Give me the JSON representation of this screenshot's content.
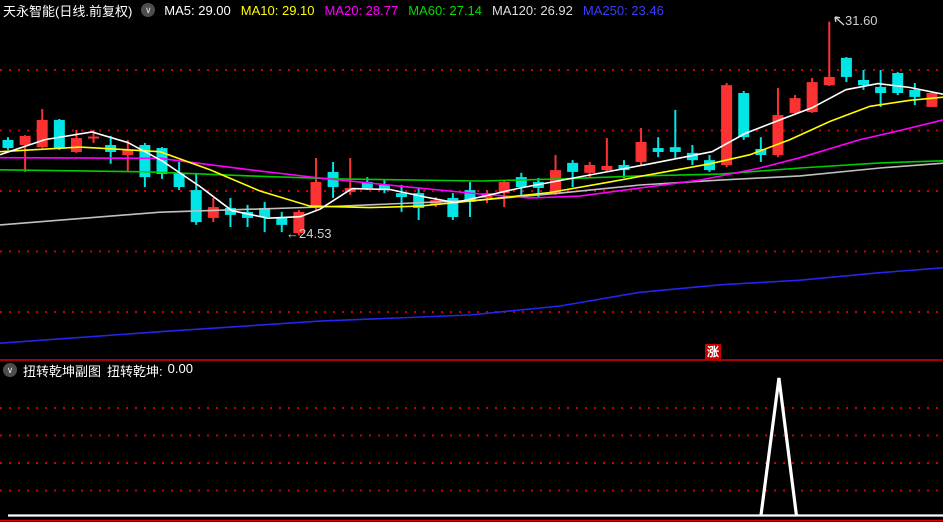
{
  "header": {
    "title": "天永智能(日线.前复权)",
    "ma_legend": [
      {
        "label": "MA5:",
        "value": "29.00",
        "color": "#ffffff"
      },
      {
        "label": "MA10:",
        "value": "29.10",
        "color": "#ffff00"
      },
      {
        "label": "MA20:",
        "value": "28.77",
        "color": "#ff00ff"
      },
      {
        "label": "MA60:",
        "value": "27.14",
        "color": "#00dd00"
      },
      {
        "label": "MA120:",
        "value": "26.92",
        "color": "#dddddd"
      },
      {
        "label": "MA250:",
        "value": "23.46",
        "color": "#3b3bff"
      }
    ]
  },
  "icons": {
    "collapse_glyph": "∨"
  },
  "annotations": {
    "high_label": "31.60",
    "low_arrow": "←",
    "low_label": "24.53",
    "zhang_badge": "涨",
    "badge_color": "#c80000"
  },
  "subchart": {
    "title": "扭转乾坤副图",
    "indicator_label": "扭转乾坤:",
    "indicator_value": "0.00"
  },
  "chart_data": {
    "type": "candlestick",
    "symbol": "天永智能",
    "period": "日线",
    "adjust": "前复权",
    "up_color": "#fa3232",
    "down_color": "#00e5e5",
    "grid_color": "#cc0000",
    "divider_color": "#e00000",
    "signal_line_color": "#ffffff",
    "price_gridlines": [
      30,
      28,
      26,
      24,
      22
    ],
    "visible_price_range": [
      20.5,
      31.65
    ],
    "high_point": {
      "bar": 48,
      "price": 31.6
    },
    "low_point": {
      "bar": 17,
      "price": 24.53
    },
    "candles": [
      {
        "o": 27.69,
        "h": 27.78,
        "l": 27.36,
        "c": 27.42
      },
      {
        "o": 27.52,
        "h": 27.85,
        "l": 26.63,
        "c": 27.82
      },
      {
        "o": 27.45,
        "h": 28.71,
        "l": 27.42,
        "c": 28.35
      },
      {
        "o": 28.35,
        "h": 28.38,
        "l": 27.36,
        "c": 27.4
      },
      {
        "o": 27.29,
        "h": 28.02,
        "l": 27.26,
        "c": 27.75
      },
      {
        "o": 27.76,
        "h": 28.02,
        "l": 27.59,
        "c": 27.8
      },
      {
        "o": 27.52,
        "h": 27.82,
        "l": 26.9,
        "c": 27.29
      },
      {
        "o": 27.19,
        "h": 27.69,
        "l": 26.63,
        "c": 27.36
      },
      {
        "o": 27.52,
        "h": 27.59,
        "l": 26.13,
        "c": 26.46
      },
      {
        "o": 27.42,
        "h": 27.45,
        "l": 26.4,
        "c": 26.56
      },
      {
        "o": 26.6,
        "h": 26.96,
        "l": 26.03,
        "c": 26.13
      },
      {
        "o": 26.03,
        "h": 26.6,
        "l": 24.88,
        "c": 24.97
      },
      {
        "o": 25.11,
        "h": 25.77,
        "l": 24.97,
        "c": 25.47
      },
      {
        "o": 25.44,
        "h": 25.77,
        "l": 24.81,
        "c": 25.21
      },
      {
        "o": 25.31,
        "h": 25.54,
        "l": 24.81,
        "c": 25.11
      },
      {
        "o": 25.44,
        "h": 25.64,
        "l": 24.64,
        "c": 25.14
      },
      {
        "o": 25.11,
        "h": 25.31,
        "l": 24.64,
        "c": 24.88
      },
      {
        "o": 24.61,
        "h": 25.37,
        "l": 24.53,
        "c": 25.31
      },
      {
        "o": 25.47,
        "h": 27.09,
        "l": 25.37,
        "c": 26.3
      },
      {
        "o": 26.63,
        "h": 26.96,
        "l": 25.77,
        "c": 26.13
      },
      {
        "o": 25.97,
        "h": 27.09,
        "l": 25.87,
        "c": 26.1
      },
      {
        "o": 26.3,
        "h": 26.46,
        "l": 26.03,
        "c": 26.1
      },
      {
        "o": 26.2,
        "h": 26.36,
        "l": 25.93,
        "c": 26.03
      },
      {
        "o": 25.93,
        "h": 26.2,
        "l": 25.31,
        "c": 25.8
      },
      {
        "o": 25.93,
        "h": 26.1,
        "l": 25.04,
        "c": 25.44
      },
      {
        "o": 25.54,
        "h": 25.8,
        "l": 25.47,
        "c": 25.7
      },
      {
        "o": 25.77,
        "h": 25.93,
        "l": 25.04,
        "c": 25.14
      },
      {
        "o": 26.03,
        "h": 26.3,
        "l": 25.14,
        "c": 25.64
      },
      {
        "o": 25.77,
        "h": 26.03,
        "l": 25.6,
        "c": 25.93
      },
      {
        "o": 25.93,
        "h": 26.36,
        "l": 25.47,
        "c": 26.3
      },
      {
        "o": 26.46,
        "h": 26.6,
        "l": 25.87,
        "c": 26.13
      },
      {
        "o": 26.3,
        "h": 26.43,
        "l": 25.8,
        "c": 26.1
      },
      {
        "o": 25.93,
        "h": 27.19,
        "l": 25.87,
        "c": 26.69
      },
      {
        "o": 26.93,
        "h": 27.02,
        "l": 26.13,
        "c": 26.63
      },
      {
        "o": 26.6,
        "h": 26.96,
        "l": 26.43,
        "c": 26.86
      },
      {
        "o": 26.69,
        "h": 27.75,
        "l": 26.63,
        "c": 26.83
      },
      {
        "o": 26.86,
        "h": 27.02,
        "l": 26.43,
        "c": 26.69
      },
      {
        "o": 26.96,
        "h": 28.08,
        "l": 26.86,
        "c": 27.62
      },
      {
        "o": 27.42,
        "h": 27.78,
        "l": 27.12,
        "c": 27.29
      },
      {
        "o": 27.45,
        "h": 28.68,
        "l": 27.09,
        "c": 27.29
      },
      {
        "o": 27.26,
        "h": 27.52,
        "l": 26.86,
        "c": 27.02
      },
      {
        "o": 27.02,
        "h": 27.19,
        "l": 26.63,
        "c": 26.69
      },
      {
        "o": 26.86,
        "h": 29.57,
        "l": 26.79,
        "c": 29.5
      },
      {
        "o": 29.24,
        "h": 29.31,
        "l": 27.69,
        "c": 27.78
      },
      {
        "o": 27.39,
        "h": 27.78,
        "l": 26.96,
        "c": 27.19
      },
      {
        "o": 27.19,
        "h": 29.41,
        "l": 27.12,
        "c": 28.51
      },
      {
        "o": 28.58,
        "h": 29.17,
        "l": 28.51,
        "c": 29.07
      },
      {
        "o": 28.61,
        "h": 29.74,
        "l": 28.58,
        "c": 29.6
      },
      {
        "o": 29.5,
        "h": 31.6,
        "l": 29.47,
        "c": 29.77
      },
      {
        "o": 30.4,
        "h": 30.43,
        "l": 29.6,
        "c": 29.77
      },
      {
        "o": 29.67,
        "h": 30.0,
        "l": 29.34,
        "c": 29.5
      },
      {
        "o": 29.44,
        "h": 30.0,
        "l": 28.78,
        "c": 29.24
      },
      {
        "o": 29.9,
        "h": 29.93,
        "l": 29.17,
        "c": 29.24
      },
      {
        "o": 29.34,
        "h": 29.57,
        "l": 28.84,
        "c": 29.11
      },
      {
        "o": 28.78,
        "h": 29.27,
        "l": 28.78,
        "c": 29.24
      }
    ],
    "ma_series": [
      {
        "name": "MA250",
        "color": "#2525ee",
        "points": [
          [
            0,
            20.97
          ],
          [
            160,
            21.35
          ],
          [
            320,
            21.7
          ],
          [
            470,
            21.9
          ],
          [
            560,
            22.2
          ],
          [
            640,
            22.65
          ],
          [
            720,
            22.9
          ],
          [
            800,
            23.05
          ],
          [
            880,
            23.3
          ],
          [
            943,
            23.46
          ]
        ]
      },
      {
        "name": "MA120",
        "color": "#c0c0c0",
        "points": [
          [
            0,
            24.88
          ],
          [
            160,
            25.3
          ],
          [
            320,
            25.47
          ],
          [
            480,
            25.7
          ],
          [
            560,
            25.93
          ],
          [
            640,
            26.2
          ],
          [
            720,
            26.36
          ],
          [
            800,
            26.5
          ],
          [
            880,
            26.76
          ],
          [
            943,
            26.92
          ]
        ]
      },
      {
        "name": "MA60",
        "color": "#00cc00",
        "points": [
          [
            0,
            26.7
          ],
          [
            150,
            26.63
          ],
          [
            250,
            26.5
          ],
          [
            340,
            26.4
          ],
          [
            480,
            26.33
          ],
          [
            560,
            26.4
          ],
          [
            640,
            26.5
          ],
          [
            720,
            26.56
          ],
          [
            800,
            26.76
          ],
          [
            880,
            26.93
          ],
          [
            943,
            27.0
          ]
        ]
      },
      {
        "name": "MA20",
        "color": "#ff00ff",
        "points": [
          [
            0,
            27.1
          ],
          [
            160,
            27.08
          ],
          [
            250,
            26.7
          ],
          [
            320,
            26.43
          ],
          [
            400,
            26.16
          ],
          [
            480,
            25.9
          ],
          [
            530,
            25.77
          ],
          [
            580,
            25.83
          ],
          [
            640,
            26.1
          ],
          [
            700,
            26.36
          ],
          [
            760,
            26.76
          ],
          [
            800,
            27.1
          ],
          [
            860,
            27.7
          ],
          [
            900,
            28.0
          ],
          [
            943,
            28.35
          ]
        ]
      },
      {
        "name": "MA10",
        "color": "#ffff00",
        "points": [
          [
            0,
            27.3
          ],
          [
            80,
            27.45
          ],
          [
            160,
            27.3
          ],
          [
            210,
            26.7
          ],
          [
            260,
            26.0
          ],
          [
            310,
            25.5
          ],
          [
            370,
            25.45
          ],
          [
            420,
            25.5
          ],
          [
            480,
            25.7
          ],
          [
            550,
            25.95
          ],
          [
            610,
            26.3
          ],
          [
            660,
            26.6
          ],
          [
            710,
            26.9
          ],
          [
            750,
            27.2
          ],
          [
            790,
            27.7
          ],
          [
            830,
            28.3
          ],
          [
            870,
            28.8
          ],
          [
            910,
            29.0
          ],
          [
            943,
            29.1
          ]
        ]
      },
      {
        "name": "MA5",
        "color": "#ffffff",
        "points": [
          [
            0,
            27.2
          ],
          [
            45,
            27.7
          ],
          [
            92,
            27.95
          ],
          [
            128,
            27.6
          ],
          [
            162,
            27.0
          ],
          [
            200,
            26.15
          ],
          [
            232,
            25.35
          ],
          [
            268,
            25.1
          ],
          [
            300,
            25.15
          ],
          [
            320,
            25.4
          ],
          [
            352,
            26.08
          ],
          [
            390,
            26.05
          ],
          [
            425,
            25.8
          ],
          [
            455,
            25.62
          ],
          [
            487,
            25.85
          ],
          [
            520,
            26.1
          ],
          [
            585,
            26.5
          ],
          [
            650,
            26.9
          ],
          [
            712,
            27.3
          ],
          [
            745,
            27.9
          ],
          [
            780,
            28.35
          ],
          [
            812,
            28.75
          ],
          [
            846,
            29.35
          ],
          [
            878,
            29.55
          ],
          [
            910,
            29.42
          ],
          [
            943,
            29.2
          ]
        ]
      }
    ],
    "signal": {
      "name": "扭转乾坤",
      "current_value": 0.0,
      "spike_bar": 45,
      "spike_label": "涨"
    }
  }
}
